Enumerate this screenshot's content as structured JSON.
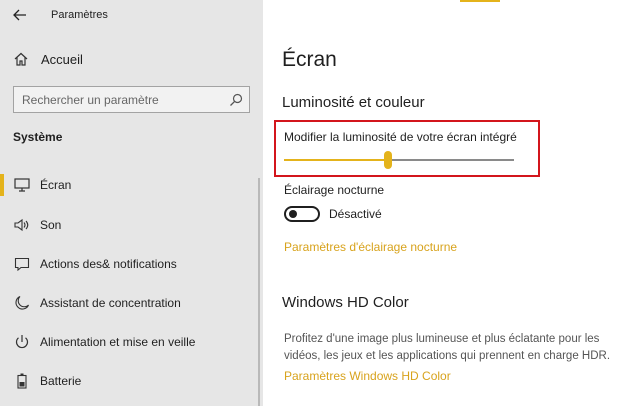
{
  "colors": {
    "accent": "#e4b31b",
    "link": "#d8a31d",
    "highlight_border": "#d3151c",
    "sidebar_bg": "#e6e6e6"
  },
  "window": {
    "title": "Paramètres"
  },
  "sidebar": {
    "home_label": "Accueil",
    "search_placeholder": "Rechercher un paramètre",
    "section_label": "Système",
    "items": [
      {
        "label": "Écran",
        "icon": "monitor-icon",
        "active": true
      },
      {
        "label": "Son",
        "icon": "speaker-icon"
      },
      {
        "label": "Actions des& notifications",
        "icon": "notification-icon"
      },
      {
        "label": "Assistant de concentration",
        "icon": "moon-icon"
      },
      {
        "label": "Alimentation et mise en veille",
        "icon": "power-icon"
      },
      {
        "label": "Batterie",
        "icon": "battery-icon"
      }
    ]
  },
  "main": {
    "title": "Écran",
    "brightness_section": {
      "heading": "Luminosité et couleur",
      "slider_label": "Modifier la luminosité de votre écran intégré",
      "slider_value": 45
    },
    "night_light": {
      "label": "Éclairage nocturne",
      "state": "Désactivé",
      "link": "Paramètres d'éclairage nocturne"
    },
    "hd_color": {
      "heading": "Windows HD Color",
      "description": "Profitez d'une image plus lumineuse et plus éclatante pour les vidéos, les jeux et les applications qui prennent en charge HDR.",
      "link": "Paramètres Windows HD Color"
    }
  }
}
